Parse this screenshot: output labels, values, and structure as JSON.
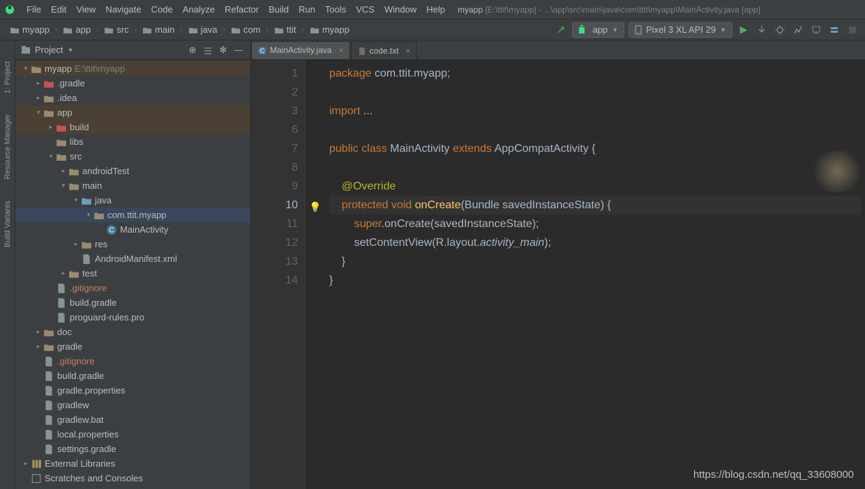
{
  "menubar": {
    "items": [
      "File",
      "Edit",
      "View",
      "Navigate",
      "Code",
      "Analyze",
      "Refactor",
      "Build",
      "Run",
      "Tools",
      "VCS",
      "Window",
      "Help"
    ],
    "title_app": "myapp",
    "title_path": "[E:\\ttit\\myapp] - ...\\app\\src\\main\\java\\com\\ttit\\myapp\\MainActivity.java [app]"
  },
  "breadcrumbs": [
    {
      "label": "myapp",
      "icon": "folder"
    },
    {
      "label": "app",
      "icon": "folder"
    },
    {
      "label": "src",
      "icon": "folder"
    },
    {
      "label": "main",
      "icon": "folder"
    },
    {
      "label": "java",
      "icon": "folder"
    },
    {
      "label": "com",
      "icon": "folder"
    },
    {
      "label": "ttit",
      "icon": "folder"
    },
    {
      "label": "myapp",
      "icon": "folder"
    }
  ],
  "toolbar": {
    "run_config": "app",
    "device": "Pixel 3 XL API 29"
  },
  "left_tabs": [
    "1: Project",
    "Resource Manager",
    "Build Variants"
  ],
  "project_pane": {
    "title": "Project"
  },
  "tree": [
    {
      "d": 0,
      "tw": "v",
      "icon": "folder-tan",
      "label": "myapp",
      "extra": "E:\\ttit\\myapp",
      "hl": true
    },
    {
      "d": 1,
      "tw": ">",
      "icon": "folder-red",
      "label": ".gradle"
    },
    {
      "d": 1,
      "tw": ">",
      "icon": "folder-tan",
      "label": ".idea"
    },
    {
      "d": 1,
      "tw": "v",
      "icon": "folder-tan",
      "label": "app",
      "hl": true
    },
    {
      "d": 2,
      "tw": ">",
      "icon": "folder-red",
      "label": "build",
      "hl": true
    },
    {
      "d": 2,
      "tw": "",
      "icon": "folder-tan",
      "label": "libs"
    },
    {
      "d": 2,
      "tw": "v",
      "icon": "folder-tan",
      "label": "src"
    },
    {
      "d": 3,
      "tw": ">",
      "icon": "folder-tan",
      "label": "androidTest"
    },
    {
      "d": 3,
      "tw": "v",
      "icon": "folder-tan",
      "label": "main"
    },
    {
      "d": 4,
      "tw": "v",
      "icon": "folder-blue",
      "label": "java"
    },
    {
      "d": 5,
      "tw": "v",
      "icon": "folder-tan",
      "label": "com.ttit.myapp",
      "selected": true
    },
    {
      "d": 6,
      "tw": "",
      "icon": "class",
      "label": "MainActivity"
    },
    {
      "d": 4,
      "tw": ">",
      "icon": "folder-tan",
      "label": "res"
    },
    {
      "d": 4,
      "tw": "",
      "icon": "file",
      "label": "AndroidManifest.xml"
    },
    {
      "d": 3,
      "tw": ">",
      "icon": "folder-tan",
      "label": "test"
    },
    {
      "d": 2,
      "tw": "",
      "icon": "file",
      "label": ".gitignore",
      "git": true
    },
    {
      "d": 2,
      "tw": "",
      "icon": "file",
      "label": "build.gradle"
    },
    {
      "d": 2,
      "tw": "",
      "icon": "file",
      "label": "proguard-rules.pro"
    },
    {
      "d": 1,
      "tw": ">",
      "icon": "folder-tan",
      "label": "doc"
    },
    {
      "d": 1,
      "tw": ">",
      "icon": "folder-tan",
      "label": "gradle"
    },
    {
      "d": 1,
      "tw": "",
      "icon": "file",
      "label": ".gitignore",
      "git": true
    },
    {
      "d": 1,
      "tw": "",
      "icon": "file",
      "label": "build.gradle"
    },
    {
      "d": 1,
      "tw": "",
      "icon": "file",
      "label": "gradle.properties"
    },
    {
      "d": 1,
      "tw": "",
      "icon": "file",
      "label": "gradlew"
    },
    {
      "d": 1,
      "tw": "",
      "icon": "file",
      "label": "gradlew.bat"
    },
    {
      "d": 1,
      "tw": "",
      "icon": "file",
      "label": "local.properties"
    },
    {
      "d": 1,
      "tw": "",
      "icon": "file",
      "label": "settings.gradle"
    },
    {
      "d": 0,
      "tw": ">",
      "icon": "lib",
      "label": "External Libraries"
    },
    {
      "d": 0,
      "tw": "",
      "icon": "scratch",
      "label": "Scratches and Consoles"
    }
  ],
  "tabs": [
    {
      "label": "MainActivity.java",
      "icon": "class",
      "active": true
    },
    {
      "label": "code.txt",
      "icon": "txt",
      "active": false
    }
  ],
  "code": {
    "lines": [
      "1",
      "2",
      "3",
      "6",
      "7",
      "8",
      "9",
      "10",
      "11",
      "12",
      "13",
      "14"
    ]
  },
  "watermark": "https://blog.csdn.net/qq_33608000"
}
